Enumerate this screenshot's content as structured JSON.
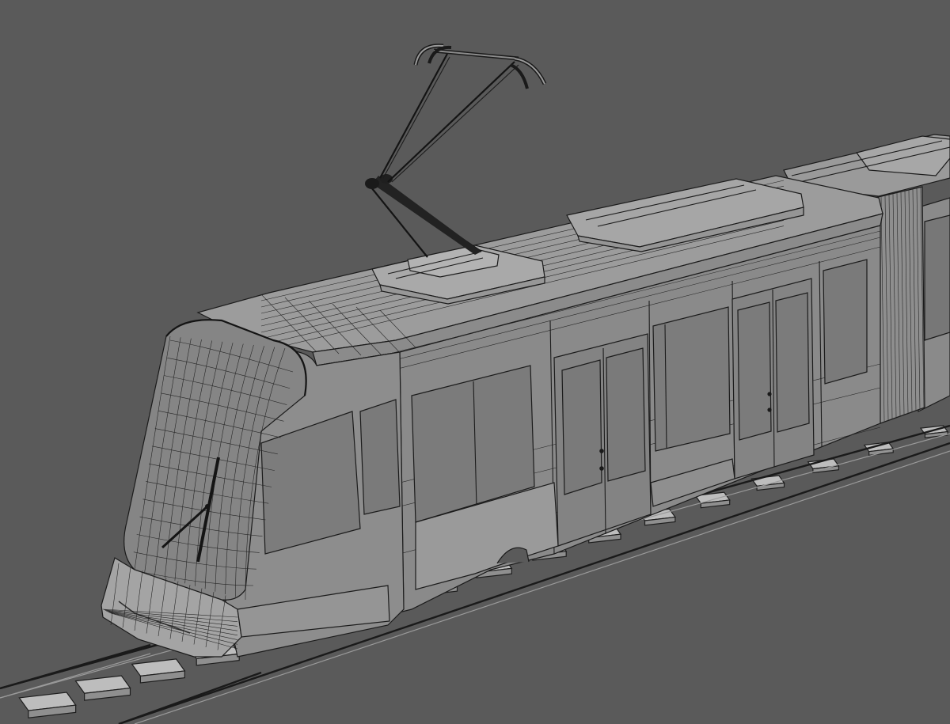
{
  "scene": {
    "subject": "",
    "colors": {
      "background": "#5a5a5a",
      "body": "#8c8c8c",
      "body_light": "#a3a3a3",
      "roof": "#9b9b9b",
      "window": "#7a7a7a",
      "wire": "#1c1c1c",
      "tie": "#bdbdbd"
    },
    "tie_count": 17
  }
}
